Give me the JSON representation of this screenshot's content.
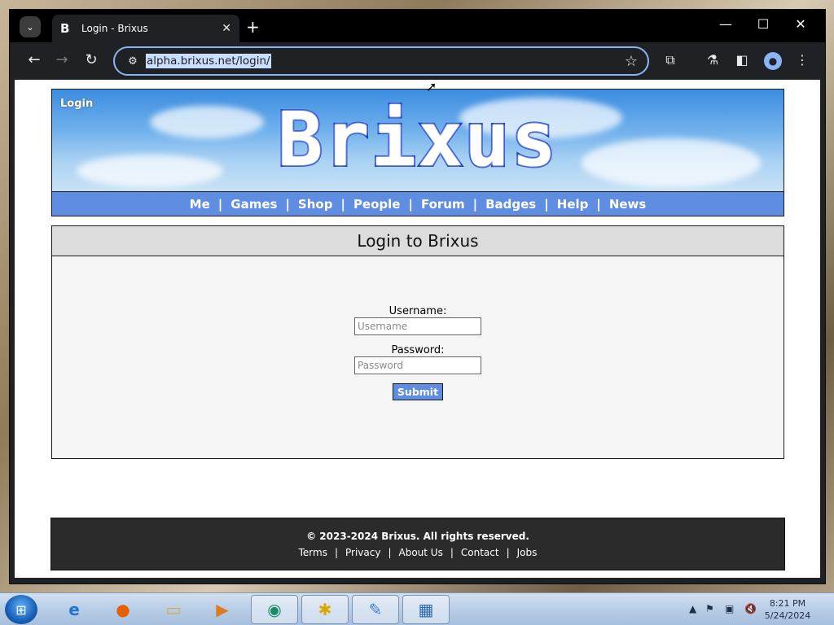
{
  "browser": {
    "tab_title": "Login - Brixus",
    "favicon_letter": "B",
    "url": "alpha.brixus.net/login/"
  },
  "page": {
    "banner_login": "Login",
    "brand": "Brixus",
    "nav": [
      "Me",
      "Games",
      "Shop",
      "People",
      "Forum",
      "Badges",
      "Help",
      "News"
    ],
    "panel_title": "Login to Brixus",
    "form": {
      "username_label": "Username:",
      "username_placeholder": "Username",
      "password_label": "Password:",
      "password_placeholder": "Password",
      "submit_label": "Submit"
    },
    "footer": {
      "copyright": "© 2023-2024 Brixus. All rights reserved.",
      "links": [
        "Terms",
        "Privacy",
        "About Us",
        "Contact",
        "Jobs"
      ]
    }
  },
  "taskbar": {
    "time": "8:21 PM",
    "date": "5/24/2024"
  },
  "colors": {
    "nav_blue": "#5f8de1",
    "footer_bg": "#2b2b2b",
    "omnibox_border": "#8ab4f8"
  }
}
